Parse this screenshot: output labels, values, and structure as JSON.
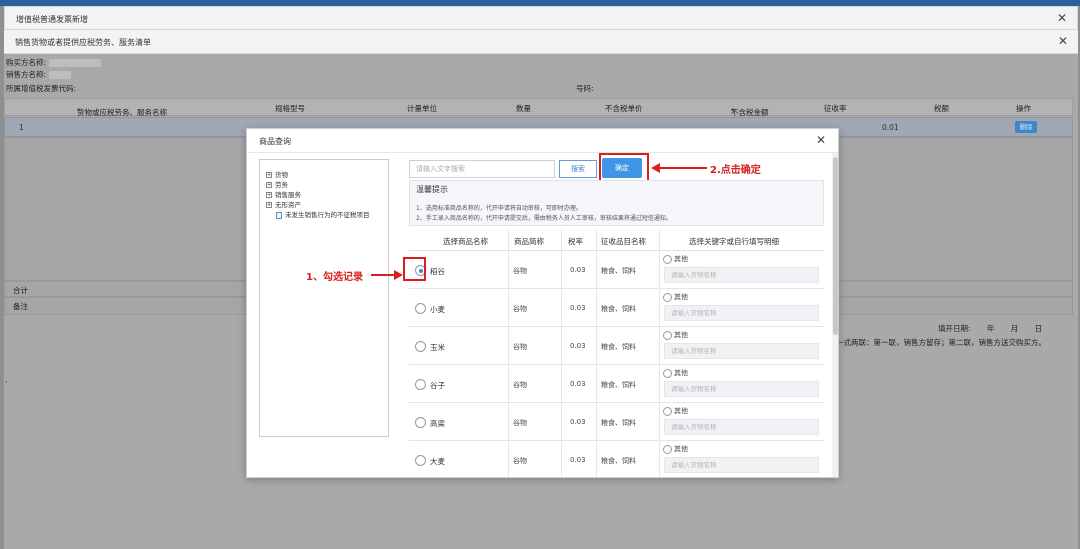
{
  "window1": {
    "title": "增值税普通发票新增"
  },
  "window2": {
    "title": "销售货物或者提供应税劳务、服务清单"
  },
  "invoice": {
    "buyer_label": "购买方名称:",
    "seller_label": "销售方名称:",
    "code_label": "所属增值税发票代码:",
    "number_label": "号码:",
    "columns": [
      "货物或应税劳务、服务名称",
      "规格型号",
      "计量单位",
      "数量",
      "不含税单价",
      "不含税金额",
      "征收率",
      "税额",
      "操作"
    ],
    "row": {
      "index": "1",
      "rate": "0.01",
      "delete_label": "删除"
    },
    "total_label": "合计",
    "note_label": "备注",
    "fill_date": "填开日期:  年  月  日",
    "copy_note": "一式两联：第一联，销售方留存；第二联，销售方送交购买方。"
  },
  "modal": {
    "title": "商品查询",
    "tree": [
      {
        "label": "货物",
        "type": "node"
      },
      {
        "label": "劳务",
        "type": "node"
      },
      {
        "label": "销售服务",
        "type": "node"
      },
      {
        "label": "无形资产",
        "type": "node"
      },
      {
        "label": "未发生销售行为的不征税项目",
        "type": "leaf"
      }
    ],
    "search_placeholder": "请输入文字搜索",
    "search_label": "搜索",
    "ok_label": "确定",
    "tip_title": "温馨提示",
    "tip_lines": [
      "1、选用标准商品名称的，代开申请将自动审核，可即时办理。",
      "2、手工录入商品名称的，代开申请提交后，需由税务人员人工审核，审核结果将通过短信通知。"
    ],
    "table_headers": [
      "选择商品名称",
      "商品简称",
      "税率",
      "征收品目名称",
      "选择关键字或自行填写明细"
    ],
    "other_label": "其他",
    "other_placeholder": "请输入货物名称",
    "products": [
      {
        "name": "稻谷",
        "short": "谷物",
        "rate": "0.03",
        "category": "粮食、饲料",
        "selected": true
      },
      {
        "name": "小麦",
        "short": "谷物",
        "rate": "0.03",
        "category": "粮食、饲料",
        "selected": false
      },
      {
        "name": "玉米",
        "short": "谷物",
        "rate": "0.03",
        "category": "粮食、饲料",
        "selected": false
      },
      {
        "name": "谷子",
        "short": "谷物",
        "rate": "0.03",
        "category": "粮食、饲料",
        "selected": false
      },
      {
        "name": "高粱",
        "short": "谷物",
        "rate": "0.03",
        "category": "粮食、饲料",
        "selected": false
      },
      {
        "name": "大麦",
        "short": "谷物",
        "rate": "0.03",
        "category": "粮食、饲料",
        "selected": false
      }
    ]
  },
  "annotations": {
    "step1": "1、勾选记录",
    "step2": "2.点击确定",
    "color": "#d81e1e"
  }
}
